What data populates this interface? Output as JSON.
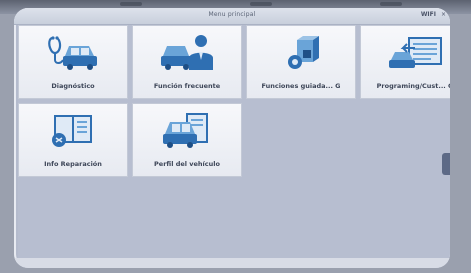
{
  "window": {
    "title": "Menu principal",
    "status": "WIFI",
    "close": "×"
  },
  "tiles": [
    {
      "label": "Diagnóstico",
      "icon": "stethoscope-car-icon"
    },
    {
      "label": "Función frecuente",
      "icon": "person-car-icon"
    },
    {
      "label": "Funciones guiada... G",
      "icon": "guided-functions-icon"
    },
    {
      "label": "Programing/Cust... G",
      "icon": "programming-screen-icon"
    },
    {
      "label": "Info Reparación",
      "icon": "repair-info-icon"
    },
    {
      "label": "Perfil del vehículo",
      "icon": "vehicle-profile-icon"
    }
  ],
  "colors": {
    "icon_primary": "#2f6fb2",
    "icon_light": "#6aa4d8",
    "tile_bg": "#f3f5f9"
  }
}
